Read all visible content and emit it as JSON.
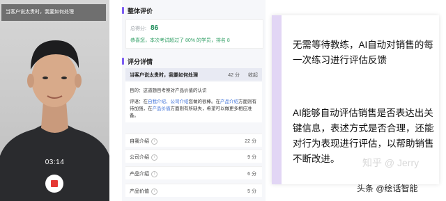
{
  "video": {
    "banner": "当客户说太贵时，我要如何处理",
    "timer": "03:14"
  },
  "overall": {
    "title": "整体评价",
    "score_label": "总得分:",
    "score": "86",
    "praise": "恭喜您，本次考试超过了 80% 的学员，排名 8"
  },
  "details": {
    "title": "评分详情",
    "question": "当客户说太贵时，我要如何处理",
    "question_score": "42 分",
    "collapse": "收起",
    "goal": "目的：这道题目考察对产品价值的认识",
    "comment_prefix": "评语：在",
    "comment_hl1": "自我介绍、公司介绍",
    "comment_mid1": "您做的很棒。在",
    "comment_hl2": "产品介绍",
    "comment_mid2": "方面则有待加强，在",
    "comment_hl3": "产品价值",
    "comment_suffix": "方面则有所缺失，希望可以做更多相应准备。",
    "items": [
      {
        "label": "自我介绍",
        "score": "22 分"
      },
      {
        "label": "公司介绍",
        "score": "9 分"
      },
      {
        "label": "产品介绍",
        "score": "6 分"
      },
      {
        "label": "产品价值",
        "score": "5 分"
      }
    ]
  },
  "card": {
    "p1": "无需等待教练，AI自动对销售的每一次练习进行评估反馈",
    "p2": "AI能够自动评估销售是否表达出关键信息，表述方式是否合理，还能对行为表现进行评估，以帮助销售不断改进。",
    "watermark": "知乎 @ Jerry",
    "source": "头条 @绘话智能"
  },
  "colors": {
    "accent": "#7c5cf3",
    "score_green": "#1a8a57",
    "stop_red": "#e53935",
    "highlight_blue": "#3b6fd8"
  }
}
